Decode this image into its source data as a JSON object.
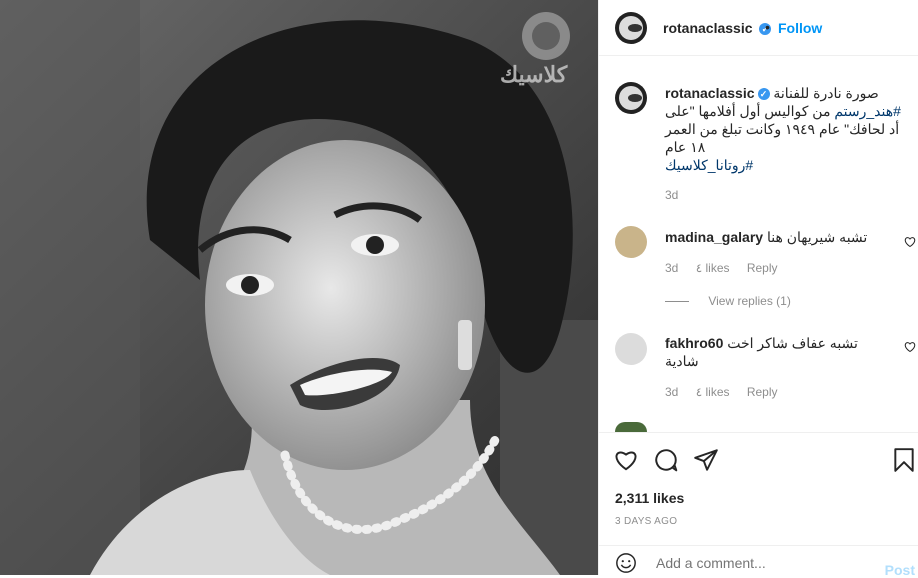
{
  "account": {
    "username": "rotanaclassic",
    "follow_label": "Follow",
    "verified": true
  },
  "photo": {
    "watermark_text": "كلاسيك",
    "description_icon": "portrait-photo"
  },
  "caption": {
    "line1": "صورة نادرة للفنانة",
    "tag1": "#هند_رستم",
    "line2": "من كواليس أول أفلامها \"على أد لحافك\" عام ١٩٤٩ وكانت تبلغ من العمر ١٨ عام",
    "tag2": "#روتانا_كلاسيك",
    "time": "3d"
  },
  "comments": [
    {
      "username": "madina_galary",
      "text": "تشبه شيريهان هنا",
      "time": "3d",
      "likes": "٤ likes",
      "reply": "Reply"
    },
    {
      "username": "fakhro60",
      "text": "تشبه عفاف شاكر اخت شادية",
      "time": "3d",
      "likes": "٤ likes",
      "reply": "Reply"
    }
  ],
  "view_replies": "View replies (1)",
  "likes_count": "2,311 likes",
  "posted_ago": "3 DAYS AGO",
  "add_comment": {
    "placeholder": "Add a comment...",
    "post_label": "Post"
  },
  "colors": {
    "link": "#0095f6",
    "verified": "#3897f0",
    "muted": "#8e8e8e"
  }
}
